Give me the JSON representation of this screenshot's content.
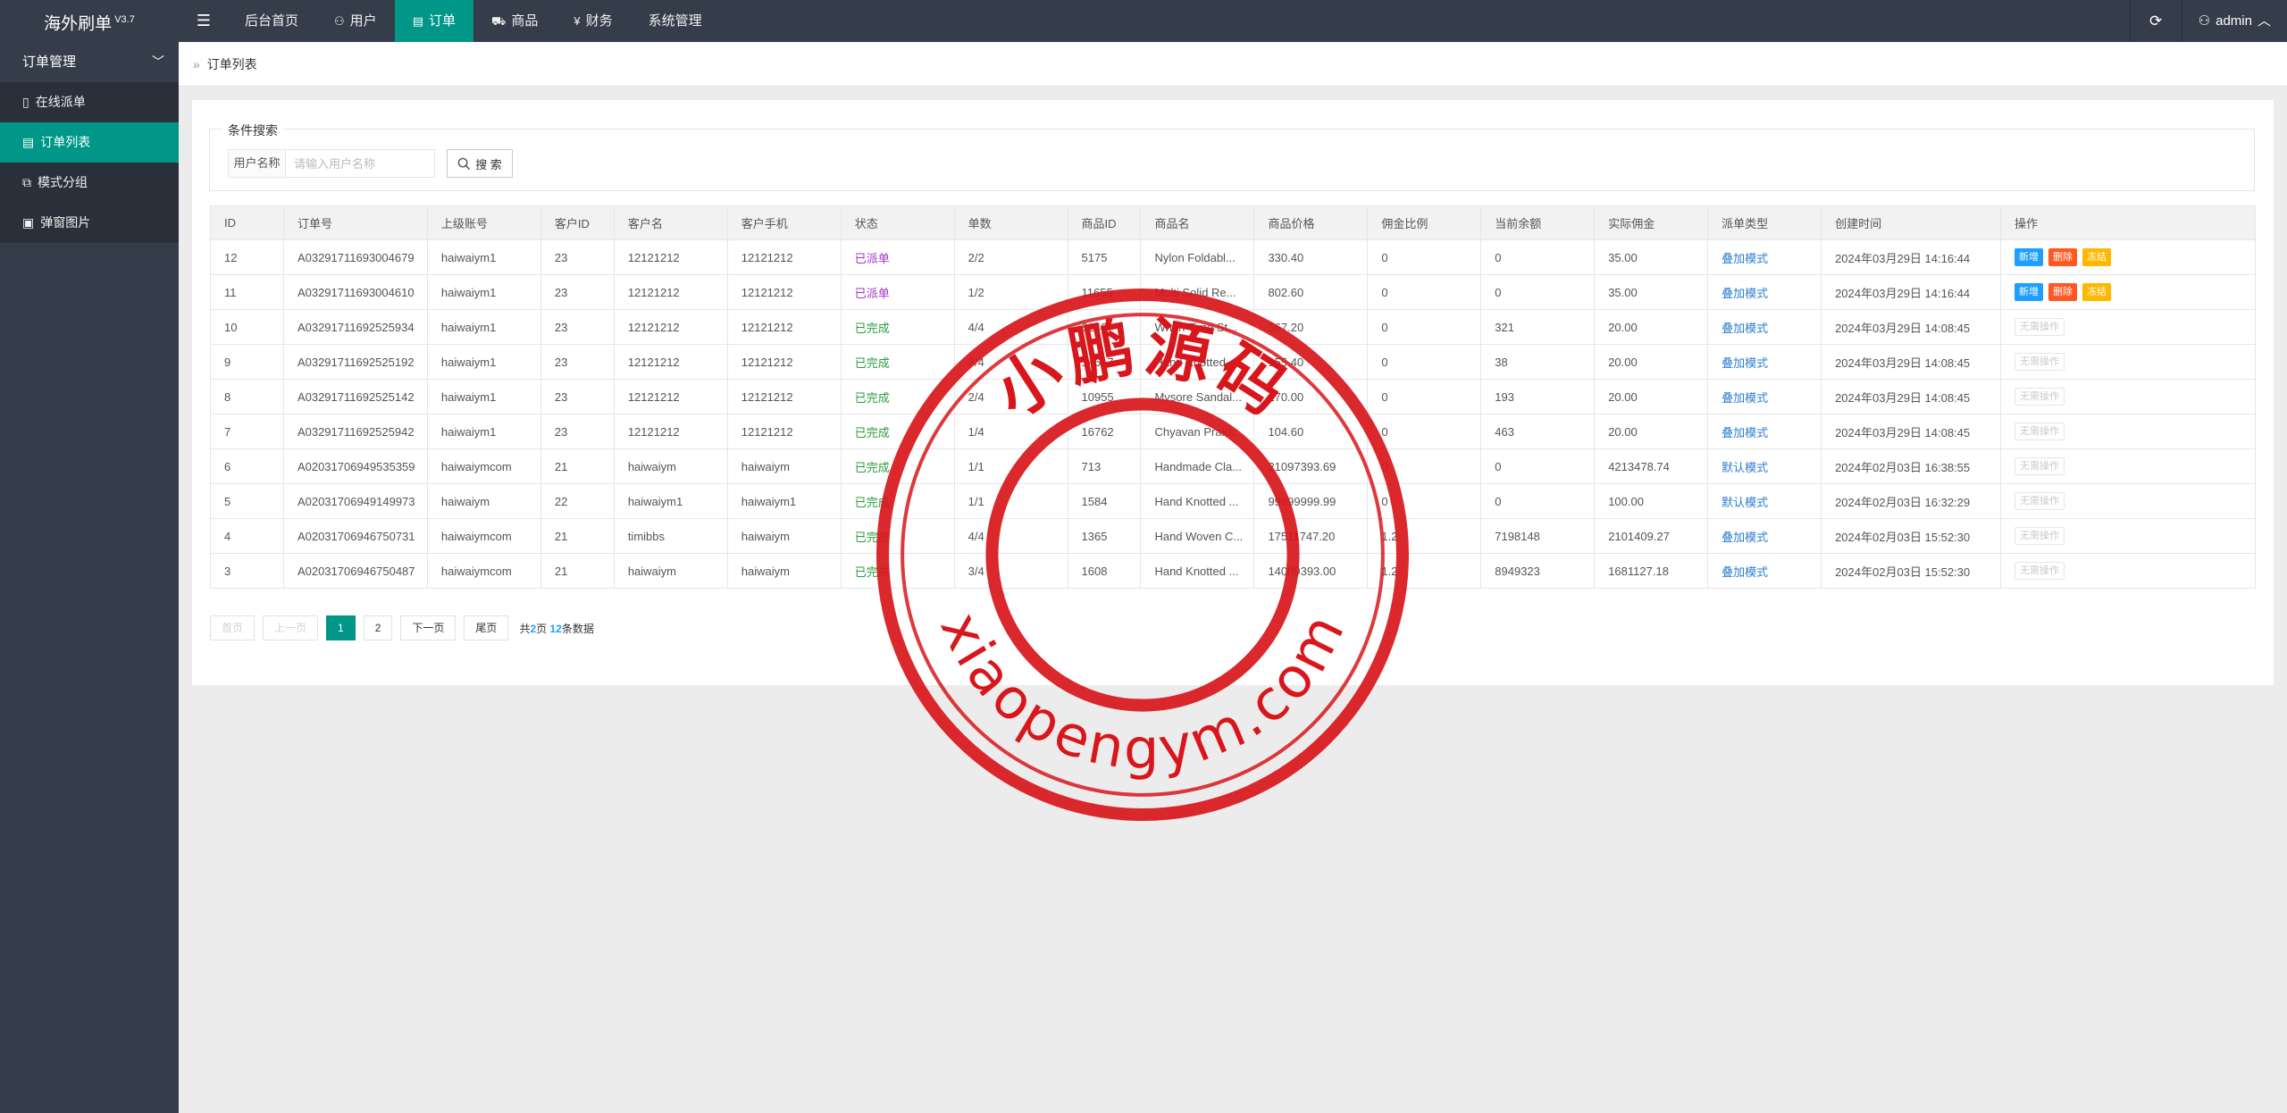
{
  "app": {
    "logo": "海外刷单",
    "version": "V3.7"
  },
  "topnav": {
    "items": [
      {
        "label": "后台首页",
        "icon": ""
      },
      {
        "label": "用户",
        "icon": "user-icon"
      },
      {
        "label": "订单",
        "icon": "file-icon",
        "active": true
      },
      {
        "label": "商品",
        "icon": "cart-icon"
      },
      {
        "label": "财务",
        "icon": "yen-icon"
      },
      {
        "label": "系统管理",
        "icon": ""
      }
    ],
    "user": "admin"
  },
  "sidebar": {
    "group": "订单管理",
    "items": [
      {
        "label": "在线派单",
        "icon": "tablet-icon"
      },
      {
        "label": "订单列表",
        "icon": "list-icon",
        "active": true
      },
      {
        "label": "模式分组",
        "icon": "group-icon"
      },
      {
        "label": "弹窗图片",
        "icon": "image-icon"
      }
    ]
  },
  "breadcrumb": "订单列表",
  "search": {
    "legend": "条件搜索",
    "label": "用户名称",
    "placeholder": "请输入用户名称",
    "button": "搜 索"
  },
  "table": {
    "headers": [
      "ID",
      "订单号",
      "上级账号",
      "客户ID",
      "客户名",
      "客户手机",
      "状态",
      "单数",
      "商品ID",
      "商品名",
      "商品价格",
      "佣金比例",
      "当前余额",
      "实际佣金",
      "派单类型",
      "创建时间",
      "操作"
    ],
    "rows": [
      {
        "id": "12",
        "order": "A03291711693004679",
        "parent": "haiwaiym1",
        "cid": "23",
        "cname": "12121212",
        "phone": "12121212",
        "status": "已派单",
        "count": "2/2",
        "pid": "5175",
        "pname": "Nylon Foldabl...",
        "price": "330.40",
        "ratio": "0",
        "balance": "0",
        "comm": "35.00",
        "mode": "叠加模式",
        "time": "2024年03月29日 14:16:44",
        "ops": "active"
      },
      {
        "id": "11",
        "order": "A03291711693004610",
        "parent": "haiwaiym1",
        "cid": "23",
        "cname": "12121212",
        "phone": "12121212",
        "status": "已派单",
        "count": "1/2",
        "pid": "11655",
        "pname": "Multi Solid Re...",
        "price": "802.60",
        "ratio": "0",
        "balance": "0",
        "comm": "35.00",
        "mode": "叠加模式",
        "time": "2024年03月29日 14:16:44",
        "ops": "active"
      },
      {
        "id": "10",
        "order": "A03291711692525934",
        "parent": "haiwaiym1",
        "cid": "23",
        "cname": "12121212",
        "phone": "12121212",
        "status": "已完成",
        "count": "4/4",
        "pid": "6249",
        "pname": "When Time St...",
        "price": "567.20",
        "ratio": "0",
        "balance": "321",
        "comm": "20.00",
        "mode": "叠加模式",
        "time": "2024年03月29日 14:08:45",
        "ops": "none"
      },
      {
        "id": "9",
        "order": "A03291711692525192",
        "parent": "haiwaiym1",
        "cid": "23",
        "cname": "12121212",
        "phone": "12121212",
        "status": "已完成",
        "count": "3/4",
        "pid": "14617",
        "pname": "Hand Knotted ...",
        "price": "155.40",
        "ratio": "0",
        "balance": "38",
        "comm": "20.00",
        "mode": "叠加模式",
        "time": "2024年03月29日 14:08:45",
        "ops": "none"
      },
      {
        "id": "8",
        "order": "A03291711692525142",
        "parent": "haiwaiym1",
        "cid": "23",
        "cname": "12121212",
        "phone": "12121212",
        "status": "已完成",
        "count": "2/4",
        "pid": "10955",
        "pname": "Mysore Sandal...",
        "price": "270.00",
        "ratio": "0",
        "balance": "193",
        "comm": "20.00",
        "mode": "叠加模式",
        "time": "2024年03月29日 14:08:45",
        "ops": "none"
      },
      {
        "id": "7",
        "order": "A03291711692525942",
        "parent": "haiwaiym1",
        "cid": "23",
        "cname": "12121212",
        "phone": "12121212",
        "status": "已完成",
        "count": "1/4",
        "pid": "16762",
        "pname": "Chyavan Praks...",
        "price": "104.60",
        "ratio": "0",
        "balance": "463",
        "comm": "20.00",
        "mode": "叠加模式",
        "time": "2024年03月29日 14:08:45",
        "ops": "none"
      },
      {
        "id": "6",
        "order": "A02031706949535359",
        "parent": "haiwaiymcom",
        "cid": "21",
        "cname": "haiwaiym",
        "phone": "haiwaiym",
        "status": "已完成",
        "count": "1/1",
        "pid": "713",
        "pname": "Handmade Cla...",
        "price": "21097393.69",
        "ratio": "0",
        "balance": "0",
        "comm": "4213478.74",
        "mode": "默认模式",
        "time": "2024年02月03日 16:38:55",
        "ops": "none"
      },
      {
        "id": "5",
        "order": "A02031706949149973",
        "parent": "haiwaiym",
        "cid": "22",
        "cname": "haiwaiym1",
        "phone": "haiwaiym1",
        "status": "已完成",
        "count": "1/1",
        "pid": "1584",
        "pname": "Hand Knotted ...",
        "price": "99999999.99",
        "ratio": "0",
        "balance": "0",
        "comm": "100.00",
        "mode": "默认模式",
        "time": "2024年02月03日 16:32:29",
        "ops": "none"
      },
      {
        "id": "4",
        "order": "A02031706946750731",
        "parent": "haiwaiymcom",
        "cid": "21",
        "cname": "timibbs",
        "phone": "haiwaiym",
        "status": "已完成",
        "count": "4/4",
        "pid": "1365",
        "pname": "Hand Woven C...",
        "price": "17511747.20",
        "ratio": "1.2",
        "balance": "7198148",
        "comm": "2101409.27",
        "mode": "叠加模式",
        "time": "2024年02月03日 15:52:30",
        "ops": "none"
      },
      {
        "id": "3",
        "order": "A02031706946750487",
        "parent": "haiwaiymcom",
        "cid": "21",
        "cname": "haiwaiym",
        "phone": "haiwaiym",
        "status": "已完成",
        "count": "3/4",
        "pid": "1608",
        "pname": "Hand Knotted ...",
        "price": "14009393.00",
        "ratio": "1.2",
        "balance": "8949323",
        "comm": "1681127.18",
        "mode": "叠加模式",
        "time": "2024年02月03日 15:52:30",
        "ops": "none"
      }
    ],
    "ops_labels": {
      "add": "新增",
      "delete": "删除",
      "freeze": "冻结",
      "none": "无需操作"
    }
  },
  "pager": {
    "first": "首页",
    "prev": "上一页",
    "pages": [
      "1",
      "2"
    ],
    "current": "1",
    "next": "下一页",
    "last": "尾页",
    "info_pre": "共",
    "total_pages": "2",
    "info_mid": "页 ",
    "total_count": "12",
    "info_post": "条数据"
  },
  "watermark": {
    "top_text": "小鹏源码",
    "bottom_text": "xiaopengym.com",
    "color": "#d8161b"
  },
  "colors": {
    "topbar": "#353c4a",
    "accent": "#009688",
    "status_dispatched": "#a233c6",
    "status_done": "#2a9d3b"
  }
}
